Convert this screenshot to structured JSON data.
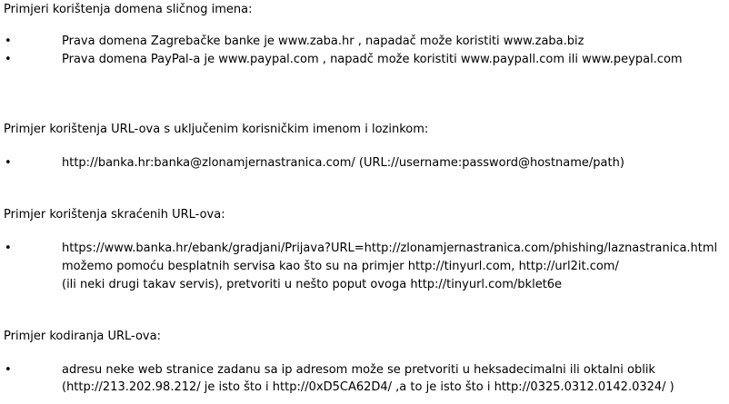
{
  "sections": [
    {
      "heading": "Primjeri korištenja domena sličnog imena:",
      "items": [
        {
          "bullet": "•",
          "lines": [
            "Prava domena Zagrebačke banke je www.zaba.hr , napadač može koristiti www.zaba.biz"
          ]
        },
        {
          "bullet": "•",
          "lines": [
            "Prava domena PayPal-a je www.paypal.com , napadč može koristiti www.paypall.com ili www.peypal.com"
          ]
        }
      ]
    },
    {
      "heading": "Primjer korištenja URL-ova s uključenim korisničkim imenom i lozinkom:",
      "items": [
        {
          "bullet": "•",
          "lines": [
            "http://banka.hr:banka@zlonamjernastranica.com/ (URL://username:password@hostname/path)"
          ]
        }
      ]
    },
    {
      "heading": "Primjer korištenja skraćenih URL-ova:",
      "items": [
        {
          "bullet": "•",
          "lines": [
            "https://www.banka.hr/ebank/gradjani/Prijava?URL=http://zlonamjernastranica.com/phishing/laznastranica.html",
            "možemo pomoću besplatnih servisa kao što su na primjer http://tinyurl.com, http://url2it.com/",
            "(ili neki drugi takav servis), pretvoriti u nešto poput ovoga http://tinyurl.com/bklet6e"
          ]
        }
      ]
    },
    {
      "heading": "Primjer kodiranja URL-ova:",
      "items": [
        {
          "bullet": "•",
          "lines": [
            "adresu neke web stranice zadanu sa ip adresom može se pretvoriti u heksadecimalni ili oktalni oblik",
            "(http://213.202.98.212/ je isto što i http://0xD5CA62D4/ ,a to je isto što i http://0325.0312.0142.0324/ )"
          ]
        }
      ]
    }
  ]
}
